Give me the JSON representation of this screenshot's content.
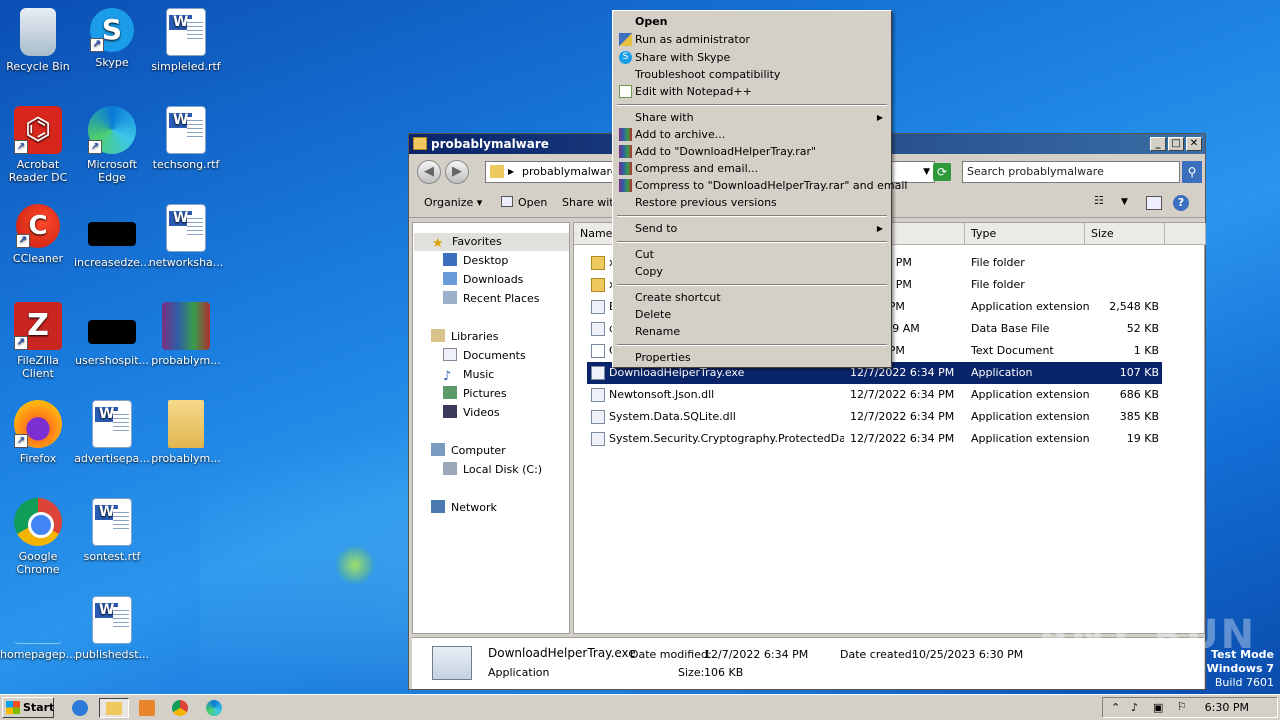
{
  "desktop": {
    "icons": [
      {
        "label": "Recycle Bin",
        "icon": "recycle-bin-icon"
      },
      {
        "label": "Skype",
        "icon": "skype-icon"
      },
      {
        "label": "simpleled.rtf",
        "icon": "word-document-icon"
      },
      {
        "label": "Acrobat Reader DC",
        "icon": "acrobat-icon"
      },
      {
        "label": "Microsoft Edge",
        "icon": "edge-icon"
      },
      {
        "label": "techsong.rtf",
        "icon": "word-document-icon"
      },
      {
        "label": "CCleaner",
        "icon": "ccleaner-icon"
      },
      {
        "label": "increasedze...",
        "icon": "blank-file-icon"
      },
      {
        "label": "networksha...",
        "icon": "word-document-icon"
      },
      {
        "label": "FileZilla Client",
        "icon": "filezilla-icon"
      },
      {
        "label": "usershospit...",
        "icon": "blank-file-icon"
      },
      {
        "label": "probablym...",
        "icon": "winrar-archive-icon"
      },
      {
        "label": "Firefox",
        "icon": "firefox-icon"
      },
      {
        "label": "advertisepa...",
        "icon": "word-document-icon"
      },
      {
        "label": "probablym...",
        "icon": "folder-icon"
      },
      {
        "label": "Google Chrome",
        "icon": "chrome-icon"
      },
      {
        "label": "sontest.rtf",
        "icon": "word-document-icon"
      },
      {
        "label": "homepagep...",
        "icon": "blank-file-icon"
      },
      {
        "label": "publishedst...",
        "icon": "word-document-icon"
      }
    ]
  },
  "explorer": {
    "title": "probablymalware",
    "address": "probablymalware",
    "search_placeholder": "Search probablymalware",
    "toolbar": {
      "organize": "Organize",
      "open": "Open",
      "share_with": "Share with"
    },
    "nav": {
      "favorites": "Favorites",
      "desktop": "Desktop",
      "downloads": "Downloads",
      "recent": "Recent Places",
      "libraries": "Libraries",
      "documents": "Documents",
      "music": "Music",
      "pictures": "Pictures",
      "videos": "Videos",
      "computer": "Computer",
      "local_disk": "Local Disk (C:)",
      "network": "Network"
    },
    "columns": {
      "name": "Name",
      "modified": "dified",
      "type": "Type",
      "size": "Size"
    },
    "rows": [
      {
        "name": "x",
        "date": "23 6:30 PM",
        "type": "File folder",
        "size": ""
      },
      {
        "name": "x",
        "date": "23 6:30 PM",
        "type": "File folder",
        "size": ""
      },
      {
        "name": "E",
        "date": "2 6:34 PM",
        "type": "Application extension",
        "size": "2,548 KB"
      },
      {
        "name": "d",
        "date": "22 11:39 AM",
        "type": "Data Base File",
        "size": "52 KB"
      },
      {
        "name": "C",
        "date": "2 6:34 PM",
        "type": "Text Document",
        "size": "1 KB"
      },
      {
        "name": "DownloadHelperTray.exe",
        "date": "12/7/2022 6:34 PM",
        "type": "Application",
        "size": "107 KB"
      },
      {
        "name": "Newtonsoft.Json.dll",
        "date": "12/7/2022 6:34 PM",
        "type": "Application extension",
        "size": "686 KB"
      },
      {
        "name": "System.Data.SQLite.dll",
        "date": "12/7/2022 6:34 PM",
        "type": "Application extension",
        "size": "385 KB"
      },
      {
        "name": "System.Security.Cryptography.ProtectedDa...",
        "date": "12/7/2022 6:34 PM",
        "type": "Application extension",
        "size": "19 KB"
      }
    ],
    "details": {
      "filename": "DownloadHelperTray.exe",
      "filetype": "Application",
      "modified_label": "Date modified:",
      "modified": "12/7/2022 6:34 PM",
      "size_label": "Size:",
      "size": "106 KB",
      "created_label": "Date created:",
      "created": "10/25/2023 6:30 PM"
    }
  },
  "context_menu": {
    "open": "Open",
    "run_admin": "Run as administrator",
    "share_skype": "Share with Skype",
    "troubleshoot": "Troubleshoot compatibility",
    "notepadpp": "Edit with Notepad++",
    "share_with": "Share with",
    "add_archive": "Add to archive...",
    "add_rar": "Add to \"DownloadHelperTray.rar\"",
    "compress_email": "Compress and email...",
    "compress_rar_email": "Compress to \"DownloadHelperTray.rar\" and email",
    "restore": "Restore previous versions",
    "send_to": "Send to",
    "cut": "Cut",
    "copy": "Copy",
    "create_shortcut": "Create shortcut",
    "delete": "Delete",
    "rename": "Rename",
    "properties": "Properties"
  },
  "taskbar": {
    "start": "Start",
    "clock": "6:30 PM"
  },
  "watermark": "ANY RUN",
  "os": {
    "mode": "Test Mode",
    "name": "Windows 7",
    "build": "Build 7601"
  }
}
